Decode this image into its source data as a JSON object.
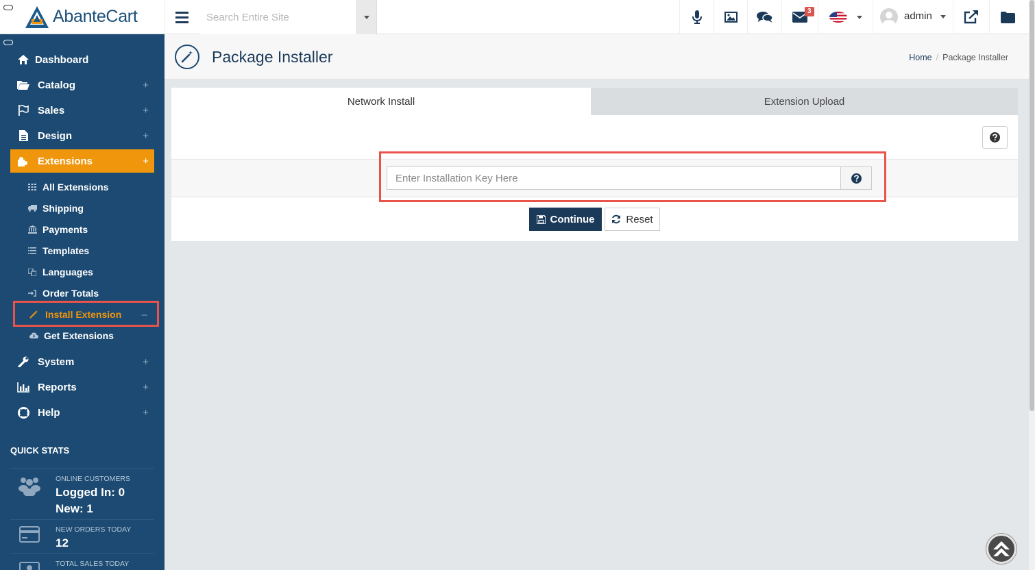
{
  "header": {
    "logo_text": "AbanteCart",
    "search_placeholder": "Search Entire Site",
    "messages_badge": "3",
    "user_name": "admin"
  },
  "sidebar": {
    "items": [
      {
        "label": "Dashboard",
        "icon": "home-icon"
      },
      {
        "label": "Catalog",
        "icon": "folder-open-icon"
      },
      {
        "label": "Sales",
        "icon": "flag-icon"
      },
      {
        "label": "Design",
        "icon": "file-icon"
      },
      {
        "label": "Extensions",
        "icon": "puzzle-icon",
        "active": true
      },
      {
        "label": "System",
        "icon": "wrench-icon"
      },
      {
        "label": "Reports",
        "icon": "bar-chart-icon"
      },
      {
        "label": "Help",
        "icon": "life-ring-icon"
      }
    ],
    "sub_items": [
      {
        "label": "All Extensions",
        "icon": "grid-icon"
      },
      {
        "label": "Shipping",
        "icon": "truck-icon"
      },
      {
        "label": "Payments",
        "icon": "bank-icon"
      },
      {
        "label": "Templates",
        "icon": "list-icon"
      },
      {
        "label": "Languages",
        "icon": "language-icon"
      },
      {
        "label": "Order Totals",
        "icon": "sign-in-icon"
      },
      {
        "label": "Install Extension",
        "icon": "magic-wand-icon",
        "current": true
      },
      {
        "label": "Get Extensions",
        "icon": "cloud-download-icon"
      }
    ],
    "quick_stats": {
      "title": "QUICK STATS",
      "online_label": "ONLINE CUSTOMERS",
      "logged_in": "Logged In: 0",
      "new": "New: 1",
      "orders_label": "NEW ORDERS TODAY",
      "orders_value": "12",
      "sales_label": "TOTAL SALES TODAY"
    }
  },
  "page": {
    "title": "Package Installer",
    "breadcrumb": {
      "home": "Home",
      "current": "Package Installer"
    },
    "tabs": [
      {
        "label": "Network Install",
        "active": true
      },
      {
        "label": "Extension Upload",
        "active": false
      }
    ],
    "key_placeholder": "Enter Installation Key Here",
    "continue_label": "Continue",
    "reset_label": "Reset"
  },
  "colors": {
    "sidebar_bg": "#1c4a72",
    "accent": "#f0960c",
    "primary_button": "#1b3a5a",
    "highlight": "#e8534a"
  }
}
